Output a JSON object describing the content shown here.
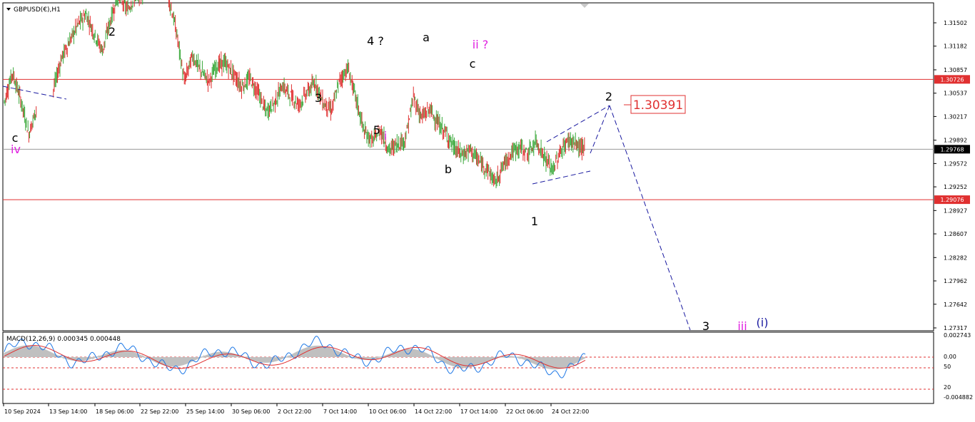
{
  "chart_data": [
    {
      "type": "candlestick",
      "title": "GBPUSD(€),H1",
      "price_axis": {
        "min": 1.27317,
        "max": 1.31502,
        "ticks": [
          "1.31502",
          "1.31182",
          "1.30857",
          "1.30537",
          "1.30217",
          "1.29892",
          "1.29572",
          "1.29252",
          "1.28927",
          "1.28607",
          "1.28282",
          "1.27962",
          "1.27642",
          "1.27317"
        ]
      },
      "horizontal_lines": [
        {
          "price": 1.30726,
          "label": "1.30726",
          "color": "#e03030"
        },
        {
          "price": 1.29076,
          "label": "1.29076",
          "color": "#e03030"
        },
        {
          "price": 1.29768,
          "label": "1.29768",
          "color": "#999999",
          "current": true
        }
      ],
      "target_label": {
        "text": "1.30391",
        "color": "#e03030"
      },
      "series": [
        {
          "kind": "ohlc",
          "bull_color": "#3aa83a",
          "bear_color": "#e03030",
          "path": [
            [
              0,
              1.3042
            ],
            [
              1,
              1.3082
            ],
            [
              2,
              1.3045
            ],
            [
              3,
              1.2998
            ],
            [
              4,
              1.3035
            ],
            [
              6,
              1.3058
            ],
            [
              7,
              1.3102
            ],
            [
              8,
              1.3125
            ],
            [
              9,
              1.3148
            ],
            [
              10,
              1.3162
            ],
            [
              11,
              1.3135
            ],
            [
              12,
              1.3112
            ],
            [
              13,
              1.3155
            ],
            [
              14,
              1.319
            ],
            [
              15,
              1.3168
            ],
            [
              16,
              1.3185
            ],
            [
              17,
              1.319
            ],
            [
              20,
              1.319
            ],
            [
              21,
              1.314
            ],
            [
              22,
              1.307
            ],
            [
              23,
              1.3105
            ],
            [
              24,
              1.3085
            ],
            [
              25,
              1.307
            ],
            [
              26,
              1.3092
            ],
            [
              27,
              1.3095
            ],
            [
              28,
              1.308
            ],
            [
              29,
              1.3062
            ],
            [
              30,
              1.3074
            ],
            [
              31,
              1.3055
            ],
            [
              32,
              1.3028
            ],
            [
              33,
              1.304
            ],
            [
              34,
              1.3064
            ],
            [
              35,
              1.305
            ],
            [
              36,
              1.3038
            ],
            [
              37,
              1.3055
            ],
            [
              38,
              1.3068
            ],
            [
              39,
              1.304
            ],
            [
              40,
              1.303
            ],
            [
              41,
              1.3072
            ],
            [
              42,
              1.3088
            ],
            [
              43,
              1.3045
            ],
            [
              44,
              1.3
            ],
            [
              45,
              1.2988
            ],
            [
              46,
              1.3003
            ],
            [
              47,
              1.2975
            ],
            [
              48,
              1.2984
            ],
            [
              49,
              1.299
            ],
            [
              50,
              1.3048
            ],
            [
              51,
              1.302
            ],
            [
              52,
              1.3032
            ],
            [
              53,
              1.3012
            ],
            [
              54,
              1.2998
            ],
            [
              55,
              1.2978
            ],
            [
              56,
              1.2969
            ],
            [
              57,
              1.2976
            ],
            [
              58,
              1.296
            ],
            [
              59,
              1.295
            ],
            [
              60,
              1.2931
            ],
            [
              61,
              1.2955
            ],
            [
              62,
              1.2972
            ],
            [
              63,
              1.298
            ],
            [
              64,
              1.297
            ],
            [
              65,
              1.2988
            ],
            [
              66,
              1.2966
            ],
            [
              67,
              1.2948
            ],
            [
              68,
              1.2974
            ],
            [
              69,
              1.299
            ],
            [
              70,
              1.2982
            ],
            [
              71,
              1.2976
            ]
          ]
        }
      ],
      "wave_labels": [
        {
          "text": "c",
          "color": "#000000"
        },
        {
          "text": "iv",
          "color": "#e020e0"
        },
        {
          "text": "2",
          "color": "#000000"
        },
        {
          "text": "3",
          "color": "#000000"
        },
        {
          "text": "4 ?",
          "color": "#000000"
        },
        {
          "text": "5",
          "color": "#000000"
        },
        {
          "text": "i",
          "color": "#e020e0"
        },
        {
          "text": "a",
          "color": "#000000"
        },
        {
          "text": "b",
          "color": "#000000"
        },
        {
          "text": "ii ?",
          "color": "#e020e0"
        },
        {
          "text": "c",
          "color": "#000000"
        },
        {
          "text": "1",
          "color": "#000000"
        },
        {
          "text": "2",
          "color": "#000000"
        },
        {
          "text": "3",
          "color": "#000000"
        },
        {
          "text": "iii",
          "color": "#e020e0"
        },
        {
          "text": "(i)",
          "color": "#1a1aa0"
        }
      ],
      "dashed_lines_color": "#1a1aa0",
      "projection_label": "1.30391"
    },
    {
      "type": "macd",
      "title": "MACD(12,26,9) 0.000345 0.000448",
      "values": {
        "macd": 0.000345,
        "signal": 0.000448
      },
      "axis": {
        "min": -0.004882,
        "max": 0.002743,
        "ticks": [
          "0.002743",
          "0.00",
          "50",
          "20",
          "-0.004882"
        ]
      },
      "levels": [
        {
          "label": "0.00",
          "color": "#e03030",
          "style": "dashed"
        },
        {
          "label": "50",
          "color": "#e03030",
          "style": "dashed"
        },
        {
          "label": "20",
          "color": "#e03030",
          "style": "dashed"
        }
      ],
      "histogram_color": "#c0c0c0",
      "signal_color": "#e03030",
      "oscillator_color": "#1e78e6"
    }
  ],
  "time_axis": {
    "labels": [
      "10 Sep 2024",
      "13 Sep 14:00",
      "18 Sep 06:00",
      "22 Sep 22:00",
      "25 Sep 14:00",
      "30 Sep 06:00",
      "2 Oct 22:00",
      "7 Oct 14:00",
      "10 Oct 06:00",
      "14 Oct 22:00",
      "17 Oct 14:00",
      "22 Oct 06:00",
      "24 Oct 22:00"
    ]
  }
}
